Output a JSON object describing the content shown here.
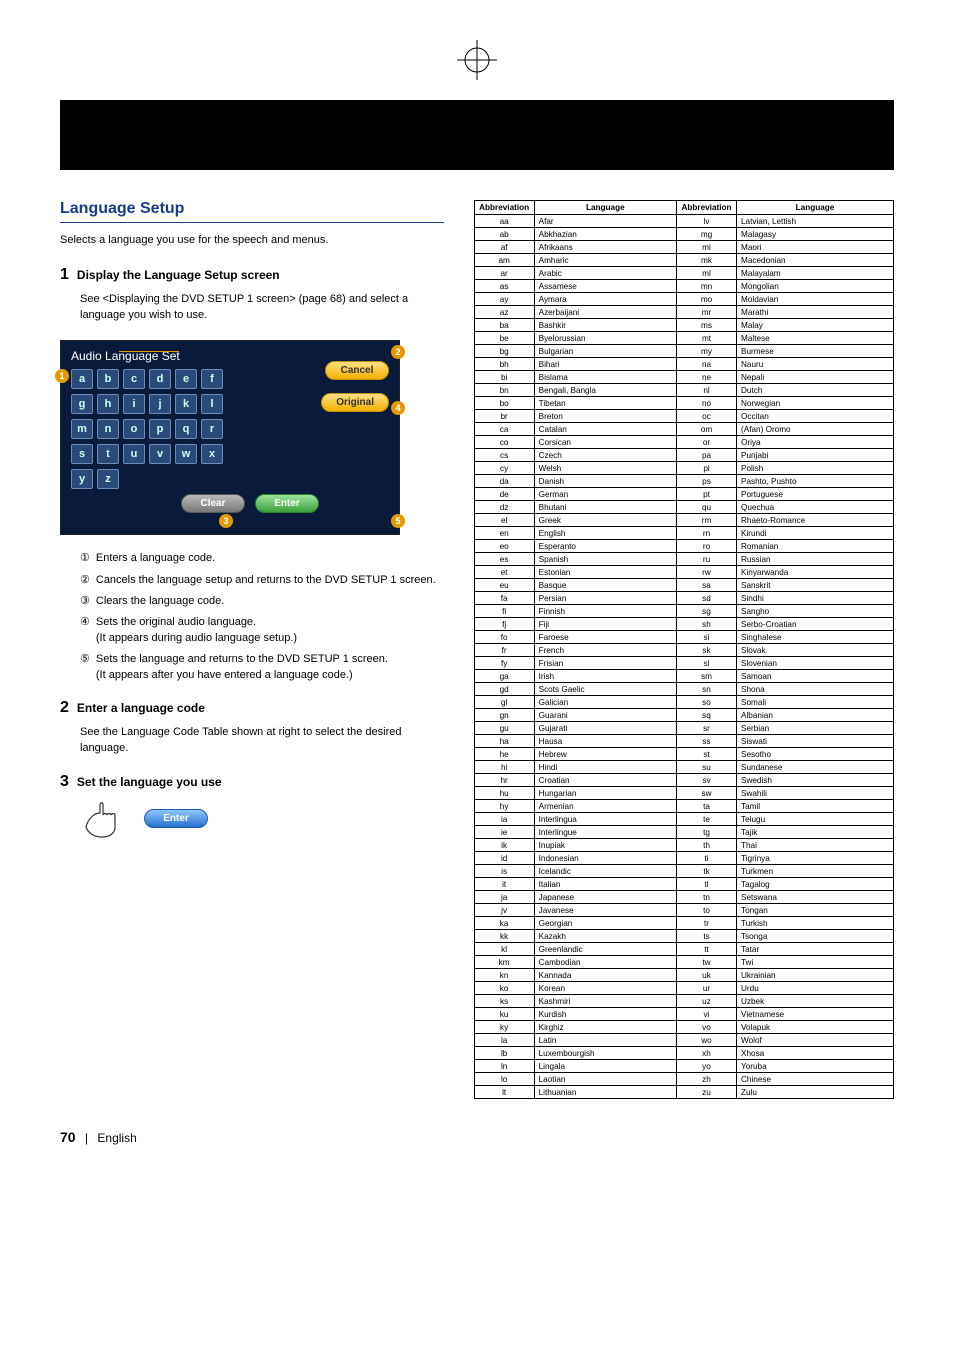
{
  "section_title": "Language Setup",
  "intro": "Selects a language you use for the speech and menus.",
  "steps": [
    {
      "num": "1",
      "title": "Display the Language Setup screen",
      "body": "See <Displaying the DVD SETUP 1 screen> (page 68) and select a language you wish to use."
    },
    {
      "num": "2",
      "title": "Enter a language code",
      "body": "See the Language Code Table shown at right to select the desired language."
    },
    {
      "num": "3",
      "title": "Set the language you use",
      "body": ""
    }
  ],
  "osd": {
    "title": "Audio Language Set",
    "btn_cancel": "Cancel",
    "btn_original": "Original",
    "btn_clear": "Clear",
    "btn_enter": "Enter",
    "rows": [
      [
        "a",
        "b",
        "c",
        "d",
        "e",
        "f"
      ],
      [
        "g",
        "h",
        "i",
        "j",
        "k",
        "l"
      ],
      [
        "m",
        "n",
        "o",
        "p",
        "q",
        "r"
      ],
      [
        "s",
        "t",
        "u",
        "v",
        "w",
        "x"
      ],
      [
        "y",
        "z"
      ]
    ]
  },
  "enum_items": [
    {
      "n": "①",
      "t": "Enters a language code."
    },
    {
      "n": "②",
      "t": "Cancels the language setup and returns to the DVD SETUP 1 screen."
    },
    {
      "n": "③",
      "t": "Clears the language code."
    },
    {
      "n": "④",
      "t": "Sets the original audio language.\n(It appears during audio language setup.)"
    },
    {
      "n": "⑤",
      "t": "Sets the language and returns to the DVD SETUP 1 screen.\n(It appears after you have entered a language code.)"
    }
  ],
  "hand_label": "Enter",
  "table_headers": {
    "abbr": "Abbreviation",
    "lang": "Language"
  },
  "table_left": [
    [
      "aa",
      "Afar"
    ],
    [
      "ab",
      "Abkhazian"
    ],
    [
      "af",
      "Afrikaans"
    ],
    [
      "am",
      "Amharic"
    ],
    [
      "ar",
      "Arabic"
    ],
    [
      "as",
      "Assamese"
    ],
    [
      "ay",
      "Aymara"
    ],
    [
      "az",
      "Azerbaijani"
    ],
    [
      "ba",
      "Bashkir"
    ],
    [
      "be",
      "Byelorussian"
    ],
    [
      "bg",
      "Bulgarian"
    ],
    [
      "bh",
      "Bihari"
    ],
    [
      "bi",
      "Bislama"
    ],
    [
      "bn",
      "Bengali, Bangla"
    ],
    [
      "bo",
      "Tibetan"
    ],
    [
      "br",
      "Breton"
    ],
    [
      "ca",
      "Catalan"
    ],
    [
      "co",
      "Corsican"
    ],
    [
      "cs",
      "Czech"
    ],
    [
      "cy",
      "Welsh"
    ],
    [
      "da",
      "Danish"
    ],
    [
      "de",
      "German"
    ],
    [
      "dz",
      "Bhutani"
    ],
    [
      "el",
      "Greek"
    ],
    [
      "en",
      "English"
    ],
    [
      "eo",
      "Esperanto"
    ],
    [
      "es",
      "Spanish"
    ],
    [
      "et",
      "Estonian"
    ],
    [
      "eu",
      "Basque"
    ],
    [
      "fa",
      "Persian"
    ],
    [
      "fi",
      "Finnish"
    ],
    [
      "fj",
      "Fiji"
    ],
    [
      "fo",
      "Faroese"
    ],
    [
      "fr",
      "French"
    ],
    [
      "fy",
      "Frisian"
    ],
    [
      "ga",
      "Irish"
    ],
    [
      "gd",
      "Scots Gaelic"
    ],
    [
      "gl",
      "Galician"
    ],
    [
      "gn",
      "Guarani"
    ],
    [
      "gu",
      "Gujarati"
    ],
    [
      "ha",
      "Hausa"
    ],
    [
      "he",
      "Hebrew"
    ],
    [
      "hi",
      "Hindi"
    ],
    [
      "hr",
      "Croatian"
    ],
    [
      "hu",
      "Hungarian"
    ],
    [
      "hy",
      "Armenian"
    ],
    [
      "ia",
      "Interlingua"
    ],
    [
      "ie",
      "Interlingue"
    ],
    [
      "ik",
      "Inupiak"
    ],
    [
      "id",
      "Indonesian"
    ],
    [
      "is",
      "Icelandic"
    ],
    [
      "it",
      "Italian"
    ],
    [
      "ja",
      "Japanese"
    ],
    [
      "jv",
      "Javanese"
    ],
    [
      "ka",
      "Georgian"
    ],
    [
      "kk",
      "Kazakh"
    ],
    [
      "kl",
      "Greenlandic"
    ],
    [
      "km",
      "Cambodian"
    ],
    [
      "kn",
      "Kannada"
    ],
    [
      "ko",
      "Korean"
    ],
    [
      "ks",
      "Kashmiri"
    ],
    [
      "ku",
      "Kurdish"
    ],
    [
      "ky",
      "Kirghiz"
    ],
    [
      "la",
      "Latin"
    ],
    [
      "lb",
      "Luxembourgish"
    ],
    [
      "ln",
      "Lingala"
    ],
    [
      "lo",
      "Laotian"
    ],
    [
      "lt",
      "Lithuanian"
    ]
  ],
  "table_right": [
    [
      "lv",
      "Latvian, Lettish"
    ],
    [
      "mg",
      "Malagasy"
    ],
    [
      "mi",
      "Maori"
    ],
    [
      "mk",
      "Macedonian"
    ],
    [
      "ml",
      "Malayalam"
    ],
    [
      "mn",
      "Mongolian"
    ],
    [
      "mo",
      "Moldavian"
    ],
    [
      "mr",
      "Marathi"
    ],
    [
      "ms",
      "Malay"
    ],
    [
      "mt",
      "Maltese"
    ],
    [
      "my",
      "Burmese"
    ],
    [
      "na",
      "Nauru"
    ],
    [
      "ne",
      "Nepali"
    ],
    [
      "nl",
      "Dutch"
    ],
    [
      "no",
      "Norwegian"
    ],
    [
      "oc",
      "Occitan"
    ],
    [
      "om",
      "(Afan) Oromo"
    ],
    [
      "or",
      "Oriya"
    ],
    [
      "pa",
      "Punjabi"
    ],
    [
      "pl",
      "Polish"
    ],
    [
      "ps",
      "Pashto, Pushto"
    ],
    [
      "pt",
      "Portuguese"
    ],
    [
      "qu",
      "Quechua"
    ],
    [
      "rm",
      "Rhaeto-Romance"
    ],
    [
      "rn",
      "Kirundi"
    ],
    [
      "ro",
      "Romanian"
    ],
    [
      "ru",
      "Russian"
    ],
    [
      "rw",
      "Kinyarwanda"
    ],
    [
      "sa",
      "Sanskrit"
    ],
    [
      "sd",
      "Sindhi"
    ],
    [
      "sg",
      "Sangho"
    ],
    [
      "sh",
      "Serbo-Croatian"
    ],
    [
      "si",
      "Singhalese"
    ],
    [
      "sk",
      "Slovak"
    ],
    [
      "sl",
      "Slovenian"
    ],
    [
      "sm",
      "Samoan"
    ],
    [
      "sn",
      "Shona"
    ],
    [
      "so",
      "Somali"
    ],
    [
      "sq",
      "Albanian"
    ],
    [
      "sr",
      "Serbian"
    ],
    [
      "ss",
      "Siswati"
    ],
    [
      "st",
      "Sesotho"
    ],
    [
      "su",
      "Sundanese"
    ],
    [
      "sv",
      "Swedish"
    ],
    [
      "sw",
      "Swahili"
    ],
    [
      "ta",
      "Tamil"
    ],
    [
      "te",
      "Telugu"
    ],
    [
      "tg",
      "Tajik"
    ],
    [
      "th",
      "Thai"
    ],
    [
      "ti",
      "Tigrinya"
    ],
    [
      "tk",
      "Turkmen"
    ],
    [
      "tl",
      "Tagalog"
    ],
    [
      "tn",
      "Setswana"
    ],
    [
      "to",
      "Tongan"
    ],
    [
      "tr",
      "Turkish"
    ],
    [
      "ts",
      "Tsonga"
    ],
    [
      "tt",
      "Tatar"
    ],
    [
      "tw",
      "Twi"
    ],
    [
      "uk",
      "Ukrainian"
    ],
    [
      "ur",
      "Urdu"
    ],
    [
      "uz",
      "Uzbek"
    ],
    [
      "vi",
      "Vietnamese"
    ],
    [
      "vo",
      "Volapuk"
    ],
    [
      "wo",
      "Wolof"
    ],
    [
      "xh",
      "Xhosa"
    ],
    [
      "yo",
      "Yoruba"
    ],
    [
      "zh",
      "Chinese"
    ],
    [
      "zu",
      "Zulu"
    ]
  ],
  "footer": {
    "page": "70",
    "lang": "English"
  }
}
